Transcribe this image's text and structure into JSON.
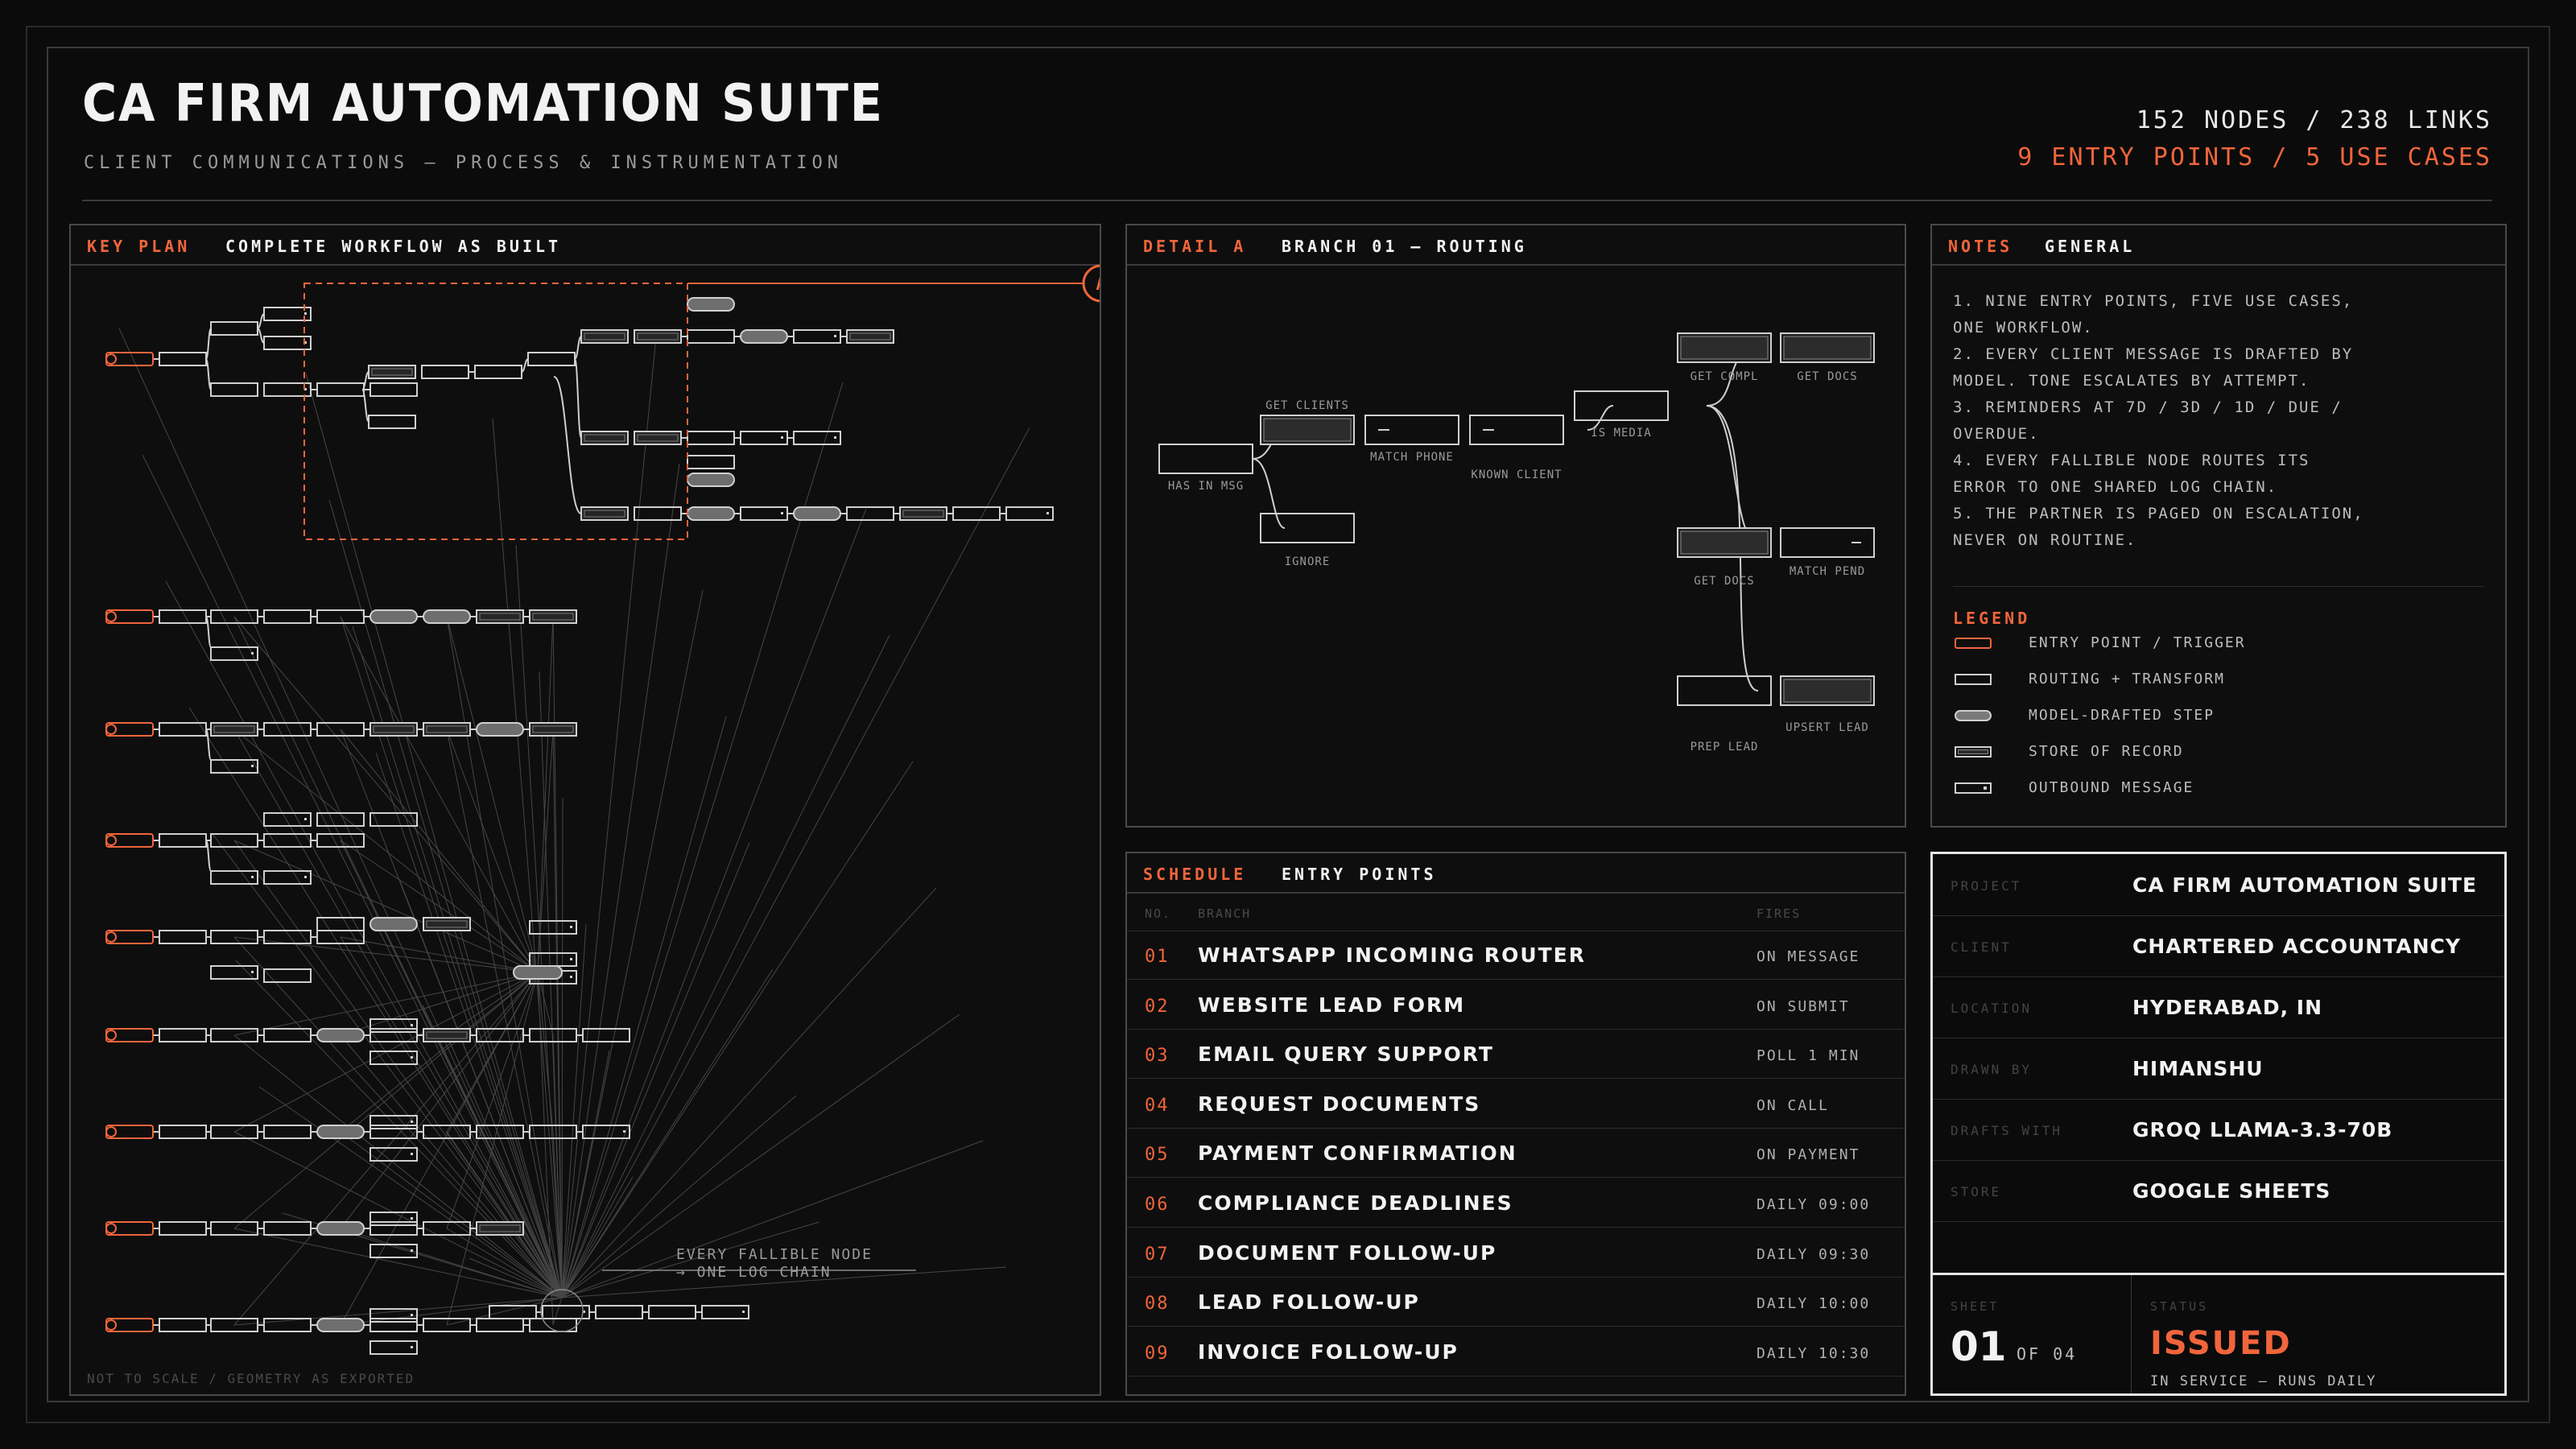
{
  "header": {
    "title": "CA FIRM AUTOMATION SUITE",
    "subtitle": "CLIENT COMMUNICATIONS — PROCESS & INSTRUMENTATION",
    "stats_primary": "152 NODES / 238 LINKS",
    "stats_secondary": "9 ENTRY POINTS / 5 USE CASES"
  },
  "key_plan": {
    "tag": "KEY PLAN",
    "title": "COMPLETE WORKFLOW AS BUILT",
    "marker": "A",
    "annotation_line1": "EVERY FALLIBLE NODE",
    "annotation_line2": "→ ONE LOG CHAIN",
    "footnote": "NOT TO SCALE / GEOMETRY AS EXPORTED"
  },
  "detail": {
    "tag": "DETAIL A",
    "title": "BRANCH 01 — ROUTING",
    "labels": {
      "has_in_msg": "HAS IN MSG",
      "get_clients": "GET CLIENTS",
      "ignore": "IGNORE",
      "match_phone": "MATCH PHONE",
      "known_client": "KNOWN CLIENT",
      "is_media": "IS MEDIA",
      "get_compl": "GET COMPL",
      "get_docs_top": "GET DOCS",
      "get_docs_mid": "GET DOCS",
      "match_pend": "MATCH PEND",
      "prep_lead": "PREP LEAD",
      "upsert_lead": "UPSERT LEAD"
    }
  },
  "notes": {
    "tag": "NOTES",
    "title": "GENERAL",
    "lines": [
      "1. NINE ENTRY POINTS, FIVE USE CASES,",
      "ONE WORKFLOW.",
      "2. EVERY CLIENT MESSAGE IS DRAFTED BY",
      "MODEL. TONE ESCALATES BY ATTEMPT.",
      "3. REMINDERS AT 7D / 3D / 1D / DUE /",
      "OVERDUE.",
      "4. EVERY FALLIBLE NODE ROUTES ITS",
      "ERROR TO ONE SHARED LOG CHAIN.",
      "5. THE PARTNER IS PAGED ON ESCALATION,",
      "NEVER ON ROUTINE."
    ],
    "legend_title": "LEGEND",
    "legend": [
      "ENTRY POINT / TRIGGER",
      "ROUTING + TRANSFORM",
      "MODEL-DRAFTED STEP",
      "STORE OF RECORD",
      "OUTBOUND MESSAGE"
    ]
  },
  "schedule": {
    "tag": "SCHEDULE",
    "title": "ENTRY POINTS",
    "col_no": "NO.",
    "col_branch": "BRANCH",
    "col_fires": "FIRES",
    "rows": [
      {
        "no": "01",
        "branch": "WHATSAPP INCOMING ROUTER",
        "fires": "ON MESSAGE"
      },
      {
        "no": "02",
        "branch": "WEBSITE LEAD FORM",
        "fires": "ON SUBMIT"
      },
      {
        "no": "03",
        "branch": "EMAIL QUERY SUPPORT",
        "fires": "POLL 1 MIN"
      },
      {
        "no": "04",
        "branch": "REQUEST DOCUMENTS",
        "fires": "ON CALL"
      },
      {
        "no": "05",
        "branch": "PAYMENT CONFIRMATION",
        "fires": "ON PAYMENT"
      },
      {
        "no": "06",
        "branch": "COMPLIANCE DEADLINES",
        "fires": "DAILY 09:00"
      },
      {
        "no": "07",
        "branch": "DOCUMENT FOLLOW-UP",
        "fires": "DAILY 09:30"
      },
      {
        "no": "08",
        "branch": "LEAD FOLLOW-UP",
        "fires": "DAILY 10:00"
      },
      {
        "no": "09",
        "branch": "INVOICE FOLLOW-UP",
        "fires": "DAILY 10:30"
      }
    ]
  },
  "title_block": {
    "rows": [
      {
        "key": "PROJECT",
        "value": "CA FIRM AUTOMATION SUITE"
      },
      {
        "key": "CLIENT",
        "value": "CHARTERED ACCOUNTANCY"
      },
      {
        "key": "LOCATION",
        "value": "HYDERABAD, IN"
      },
      {
        "key": "DRAWN BY",
        "value": "HIMANSHU"
      },
      {
        "key": "DRAFTS WITH",
        "value": "GROQ LLAMA-3.3-70B"
      },
      {
        "key": "STORE",
        "value": "GOOGLE SHEETS"
      }
    ],
    "sheet_label": "SHEET",
    "sheet_no": "01",
    "sheet_of": "OF 04",
    "status_label": "STATUS",
    "status": "ISSUED",
    "status_note": "IN SERVICE — RUNS DAILY"
  },
  "colors": {
    "accent": "#f0653c",
    "line": "#d0d0d0",
    "background": "#0b0b0b"
  }
}
